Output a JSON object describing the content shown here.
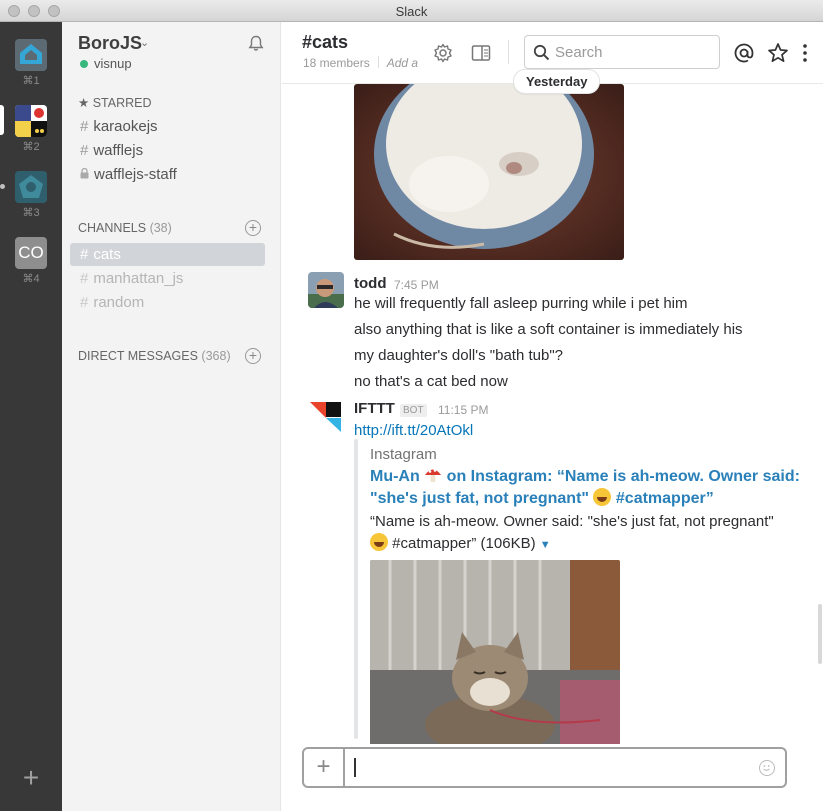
{
  "window": {
    "title": "Slack"
  },
  "teams": [
    {
      "shortcut": "⌘1",
      "initials": ""
    },
    {
      "shortcut": "⌘2",
      "initials": ""
    },
    {
      "shortcut": "⌘3",
      "initials": ""
    },
    {
      "shortcut": "⌘4",
      "initials": "CO"
    }
  ],
  "sidebar": {
    "team_name": "BoroJS",
    "user_name": "visnup",
    "starred_label": "STARRED",
    "starred": [
      {
        "name": "karaokejs",
        "prefix": "#"
      },
      {
        "name": "wafflejs",
        "prefix": "#"
      },
      {
        "name": "wafflejs-staff",
        "prefix": "lock"
      }
    ],
    "channels_label": "CHANNELS",
    "channels_count": "(38)",
    "channels": [
      {
        "name": "cats"
      },
      {
        "name": "manhattan_js"
      },
      {
        "name": "random"
      }
    ],
    "dms_label": "DIRECT MESSAGES",
    "dms_count": "(368)"
  },
  "header": {
    "channel": "#cats",
    "members": "18 members",
    "add_topic": "Add a",
    "search_placeholder": "Search",
    "day_divider": "Yesterday"
  },
  "messages": [
    {
      "author": "todd",
      "time": "7:45 PM",
      "lines": [
        "he will frequently fall asleep purring while i pet him",
        "also anything that is like a soft container is immediately his",
        "my daughter's doll's \"bath tub\"?",
        "no that's a cat bed now"
      ]
    },
    {
      "author": "IFTTT",
      "badge": "BOT",
      "time": "11:15 PM",
      "link": "http://ift.tt/20AtOkl",
      "attachment": {
        "service": "Instagram",
        "title_1a": "Mu-An",
        "title_1b": "on Instagram: “Name is ah-meow. Owner said:",
        "title_2a": "\"she's just fat, not pregnant\"",
        "title_2b": "#catmapper”",
        "text_1": "“Name is ah-meow. Owner said: \"she's just fat, not pregnant\"",
        "text_2": "#catmapper” (106KB)"
      }
    }
  ],
  "composer": {
    "value": ""
  },
  "colors": {
    "sidebar_bg": "#f3f3f3",
    "team_bar": "#383838",
    "link": "#0576b9",
    "presence": "#38b87c"
  }
}
